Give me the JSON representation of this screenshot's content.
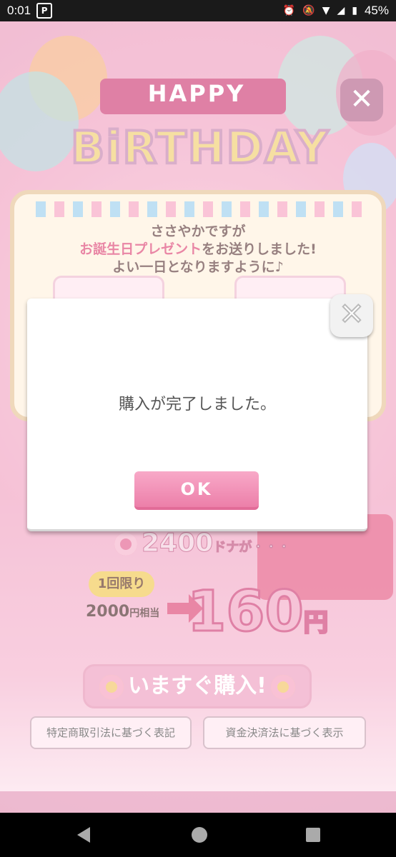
{
  "status_bar": {
    "time": "0:01",
    "app_icon_glyph": "P",
    "battery": "45%",
    "icons": [
      "alarm-icon",
      "mute-icon",
      "wifi-icon",
      "signal-icon",
      "battery-icon"
    ]
  },
  "game": {
    "ribbon_text": "HAPPY",
    "title": "BiRTHDAY",
    "close_glyph": "✕",
    "message_line1": "ささやかですが",
    "message_line2_pink": "お誕生日プレゼント",
    "message_line2_rest": "をお送りしました!",
    "message_line3": "よい一日となりますように♪",
    "donut_amount": "2400",
    "donut_unit": "ドナが・・・",
    "limit_badge": "1回限り",
    "old_price": "2000",
    "old_price_unit": "円相当",
    "new_price": "160",
    "new_price_unit": "円",
    "buy_now": "いますぐ購入!",
    "legal_commerce": "特定商取引法に基づく表記",
    "legal_payment": "資金決済法に基づく表示"
  },
  "dialog": {
    "message": "購入が完了しました。",
    "ok_label": "OK",
    "close_glyph": "✕"
  },
  "colors": {
    "accent_pink": "#ec7fa9",
    "status_bar": "#1a1a1a"
  }
}
